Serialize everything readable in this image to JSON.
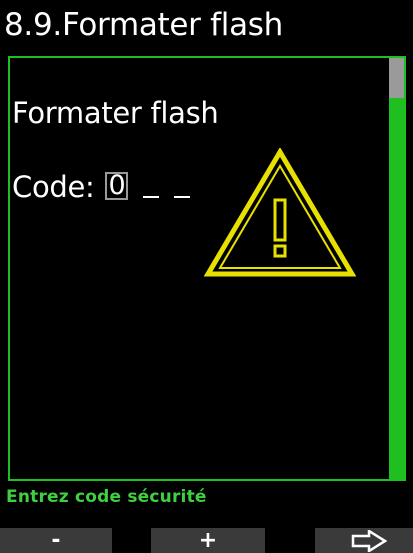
{
  "header": {
    "title": "8.9.Formater flash"
  },
  "panel": {
    "title": "Formater flash",
    "code_label": "Code:",
    "code_digit": "0",
    "warning_icon": "warning-triangle-icon"
  },
  "status": {
    "message": "Entrez code sécurité"
  },
  "softkeys": {
    "left_label": "-",
    "middle_label": "+",
    "right_icon": "arrow-right-icon"
  },
  "colors": {
    "accent_green": "#1fbf1f",
    "warning_yellow": "#e8e000",
    "text": "#ffffff",
    "background": "#000000"
  }
}
